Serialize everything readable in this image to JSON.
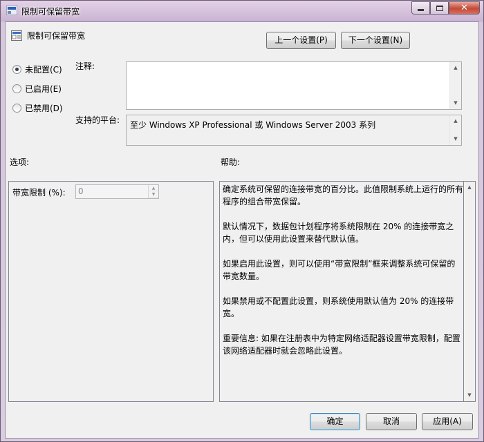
{
  "window": {
    "title": "限制可保留带宽",
    "close_glyph": "✕"
  },
  "header": {
    "policy_title": "限制可保留带宽",
    "prev_button": "上一个设置(P)",
    "next_button": "下一个设置(N)"
  },
  "radios": [
    {
      "label": "未配置(C)",
      "checked": true
    },
    {
      "label": "已启用(E)",
      "checked": false
    },
    {
      "label": "已禁用(D)",
      "checked": false
    }
  ],
  "comment": {
    "label": "注释:",
    "value": ""
  },
  "platform": {
    "label": "支持的平台:",
    "value": "至少 Windows XP Professional 或 Windows Server 2003 系列"
  },
  "options": {
    "label": "选项:",
    "bandwidth_label": "带宽限制 (%):",
    "bandwidth_value": "0"
  },
  "help": {
    "label": "帮助:",
    "text": "确定系统可保留的连接带宽的百分比。此值限制系统上运行的所有程序的组合带宽保留。\n\n默认情况下，数据包计划程序将系统限制在 20% 的连接带宽之内，但可以使用此设置来替代默认值。\n\n如果启用此设置，则可以使用“带宽限制”框来调整系统可保留的带宽数量。\n\n如果禁用或不配置此设置，则系统使用默认值为 20% 的连接带宽。\n\n重要信息: 如果在注册表中为特定网络适配器设置带宽限制，配置该网络适配器时就会忽略此设置。"
  },
  "footer": {
    "ok": "确定",
    "cancel": "取消",
    "apply": "应用(A)"
  },
  "icons": {
    "up_arrow": "▲",
    "down_arrow": "▼"
  }
}
